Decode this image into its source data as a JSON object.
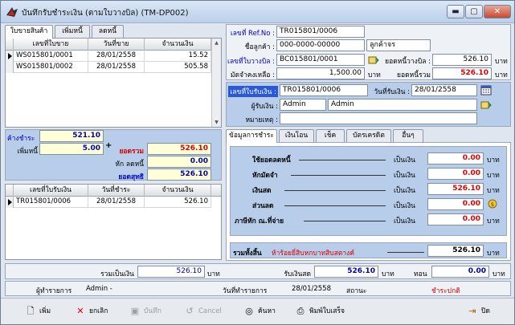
{
  "window": {
    "title": "บันทึกรับชำระเงิน (ตามใบวางบิล) (TM-DP002)"
  },
  "left_tabs": [
    "ใบขายสินค้า",
    "เพิ่มหนี้",
    "ลดหนี้"
  ],
  "sales_grid": {
    "headers": [
      "เลขที่ใบขาย",
      "วันที่ขาย",
      "จำนวนเงิน"
    ],
    "rows": [
      {
        "no": "WS015801/0001",
        "date": "28/01/2558",
        "amount": "15.52"
      },
      {
        "no": "WS015801/0002",
        "date": "28/01/2558",
        "amount": "505.58"
      }
    ]
  },
  "header": {
    "ref_label": "เลขที่ Ref.No :",
    "ref_value": "TR015801/0006",
    "customer_label": "ชื่อลูกค้า :",
    "customer_code": "000-0000-00000",
    "customer_name": "ลูกค้าจร",
    "bill_label": "เลขที่ใบวางบิล :",
    "bill_value": "BC015801/0001",
    "bill_total_label": "ยอดหนี้วางบิล :",
    "bill_total_value": "526.10",
    "bill_total_unit": "บาท",
    "deposit_label": "มัดจำคงเหลือ :",
    "deposit_value": "1,500.00",
    "deposit_unit": "บาท",
    "total_debt_label": "ยอดหนี้รวม",
    "total_debt_value": "526.10",
    "total_debt_unit": "บาท"
  },
  "receipt": {
    "no_label": "เลขที่ใบรับเงิน :",
    "no_value": "TR015801/0006",
    "date_label": "วันที่รับเงิน :",
    "date_value": "28/01/2558",
    "receiver_label": "ผู้รับเงิน :",
    "receiver_code": "Admin",
    "receiver_name": "Admin",
    "note_label": "หมายเหตุ :",
    "note_value": ""
  },
  "summary_left": {
    "outstanding_label": "ค้างชำระ",
    "outstanding_value": "521.10",
    "add_debt_label": "เพิ่มหนี้",
    "add_debt_value": "5.00",
    "total_label": "ยอดรวม",
    "total_value": "526.10",
    "deduct_label": "หัก ลดหนี้",
    "deduct_value": "0.00",
    "net_label": "ยอดสุทธิ",
    "net_value": "526.10"
  },
  "receipt_grid": {
    "headers": [
      "เลขที่ใบรับเงิน",
      "วันที่ชำระ",
      "จำนวนเงิน"
    ],
    "rows": [
      {
        "no": "TR015801/0006",
        "date": "28/01/2558",
        "amount": "526.10"
      }
    ]
  },
  "pay_tabs": [
    "ข้อมูลการชำระ",
    "เงินโอน",
    "เช็ค",
    "บัตรเครดิต",
    "อื่นๆ"
  ],
  "payment": {
    "rows": [
      {
        "label": "ใช้ยอดลดหนี้",
        "prefix": "เป็นเงิน",
        "value": "0.00",
        "unit": "บาท"
      },
      {
        "label": "หักมัดจำ",
        "prefix": "เป็นเงิน",
        "value": "0.00",
        "unit": "บาท"
      },
      {
        "label": "เงินสด",
        "prefix": "เป็นเงิน",
        "value": "526.10",
        "unit": "บาท"
      },
      {
        "label": "ส่วนลด",
        "prefix": "เป็นเงิน",
        "value": "0.00",
        "unit": "บาท"
      },
      {
        "label": "ภาษีหัก ณ.ที่จ่าย",
        "prefix": "เป็นเงิน",
        "value": "0.00",
        "unit": "บาท"
      }
    ],
    "grand_label": "รวมทั้งสิ้น",
    "grand_text": "ห้าร้อยยี่สิบหกบาทสิบสตางค์",
    "grand_value": "526.10",
    "grand_unit": "บาท"
  },
  "footer": {
    "sum_label": "รวมเป็นเงิน",
    "sum_value": "526.10",
    "sum_unit": "บาท",
    "cash_label": "รับเงินสด",
    "cash_value": "526.10",
    "cash_unit": "บาท",
    "change_label": "ทอน",
    "change_value": "0.00",
    "change_unit": "บาท",
    "recorder_label": "ผู้ทำรายการ",
    "recorder_value": "Admin -",
    "rec_date_label": "วันที่ทำรายการ",
    "rec_date_value": "28/01/2558",
    "status_label": "สถานะ",
    "status_value": "ชำระปกติ"
  },
  "toolbar": [
    "เพิ่ม",
    "ยกเลิก",
    "บันทึก",
    "Cancel",
    "ค้นหา",
    "พิมพ์ใบเสร็จ",
    "ปิด"
  ],
  "colors": {
    "accent_blue": "#2b58d6",
    "red_text": "#e00000",
    "yellow_field": "#ffffd8"
  }
}
